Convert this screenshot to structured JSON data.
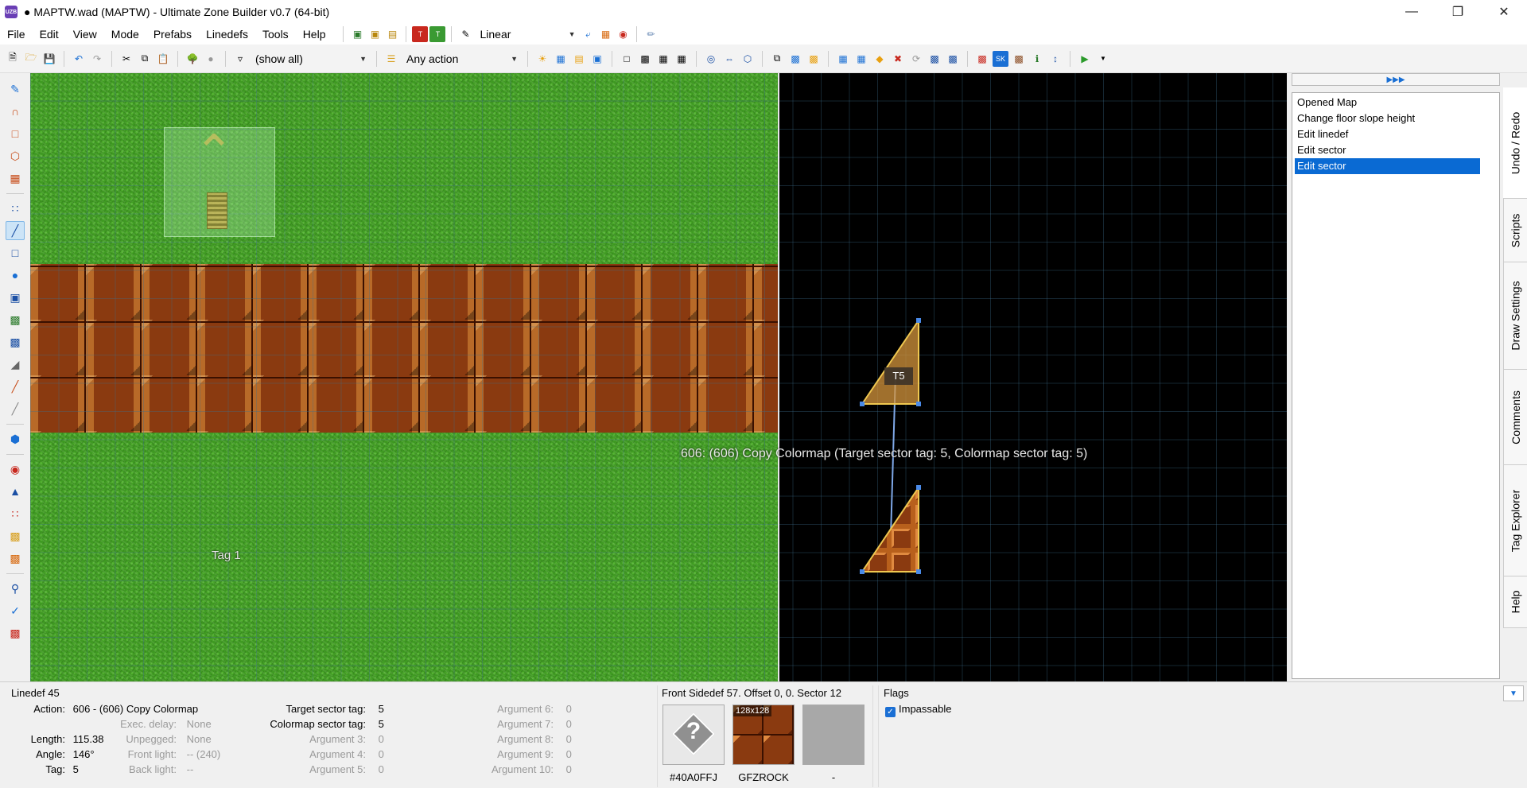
{
  "window": {
    "title": "● MAPTW.wad (MAPTW) - Ultimate Zone Builder v0.7 (64-bit)",
    "app_icon_text": "UZB",
    "controls": [
      "minimize-icon",
      "restore-icon",
      "close-icon"
    ]
  },
  "menubar": {
    "items": [
      "File",
      "Edit",
      "View",
      "Mode",
      "Prefabs",
      "Linedefs",
      "Tools",
      "Help"
    ],
    "interpolation_combo": "Linear"
  },
  "toolbar": {
    "filter_combo": "(show all)",
    "action_combo": "Any action"
  },
  "canvas": {
    "tag_label": "Tag 1",
    "action_label": "606: (606) Copy Colormap (Target sector tag: 5, Colormap sector tag: 5)",
    "sector_tag_badge": "T5"
  },
  "undo_panel": {
    "items": [
      {
        "label": "Opened Map",
        "selected": false
      },
      {
        "label": "Change floor slope height",
        "selected": false
      },
      {
        "label": "Edit linedef",
        "selected": false
      },
      {
        "label": "Edit sector",
        "selected": false
      },
      {
        "label": "Edit sector",
        "selected": true
      }
    ]
  },
  "side_tabs": [
    "Undo / Redo",
    "Scripts",
    "Draw Settings",
    "Comments",
    "Tag Explorer",
    "Help"
  ],
  "info": {
    "linedef_title": "Linedef 45",
    "action_label": "Action:",
    "action_value": "606 - (606) Copy Colormap",
    "exec_delay_label": "Exec. delay:",
    "exec_delay_value": "None",
    "length_label": "Length:",
    "length_value": "115.38",
    "unpegged_label": "Unpegged:",
    "unpegged_value": "None",
    "angle_label": "Angle:",
    "angle_value": "146°",
    "front_light_label": "Front light:",
    "front_light_value": "-- (240)",
    "tag_label": "Tag:",
    "tag_value": "5",
    "back_light_label": "Back light:",
    "back_light_value": "--",
    "args": [
      {
        "label": "Target sector tag:",
        "value": "5",
        "dim": false
      },
      {
        "label": "Colormap sector tag:",
        "value": "5",
        "dim": false
      },
      {
        "label": "Argument 3:",
        "value": "0",
        "dim": true
      },
      {
        "label": "Argument 4:",
        "value": "0",
        "dim": true
      },
      {
        "label": "Argument 5:",
        "value": "0",
        "dim": true
      },
      {
        "label": "Argument 6:",
        "value": "0",
        "dim": true
      },
      {
        "label": "Argument 7:",
        "value": "0",
        "dim": true
      },
      {
        "label": "Argument 8:",
        "value": "0",
        "dim": true
      },
      {
        "label": "Argument 9:",
        "value": "0",
        "dim": true
      },
      {
        "label": "Argument 10:",
        "value": "0",
        "dim": true
      }
    ],
    "sidedef_title": "Front Sidedef 57. Offset 0, 0. Sector 12",
    "textures": [
      {
        "caption": "#40A0FFJ",
        "kind": "missing"
      },
      {
        "caption": "GFZROCK",
        "kind": "rock",
        "size_badge": "128x128"
      },
      {
        "caption": "-",
        "kind": "empty"
      }
    ],
    "flags_title": "Flags",
    "flags": [
      {
        "label": "Impassable",
        "checked": true
      }
    ]
  }
}
